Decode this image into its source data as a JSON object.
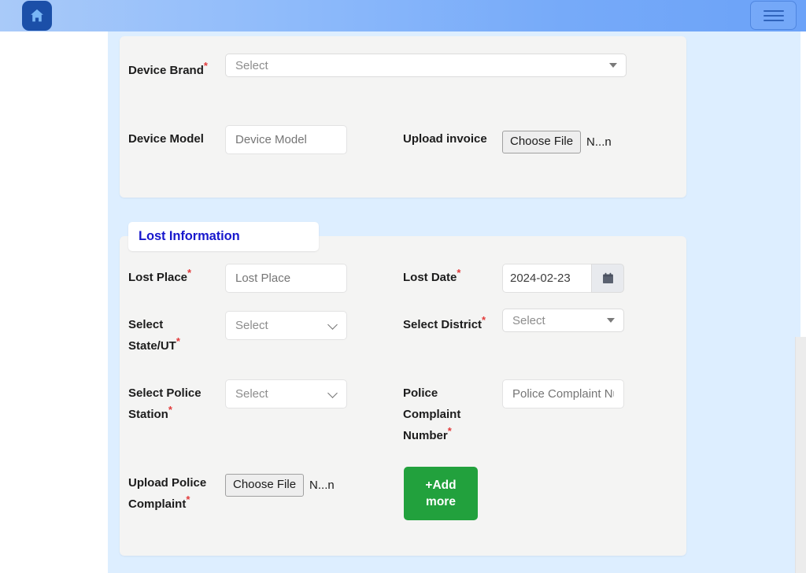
{
  "header": {
    "home_icon": "home-icon",
    "menu_icon": "hamburger-menu-icon",
    "gradient_from": "#a9caf9",
    "gradient_to": "#6ba2f8"
  },
  "device_section": {
    "fields": {
      "device_brand": {
        "label": "Device Brand",
        "required": "*",
        "value": "Select",
        "caret": "triangle-down-icon"
      },
      "device_model": {
        "label": "Device Model",
        "required": "",
        "placeholder": "Device Model",
        "value": ""
      },
      "upload_invoice": {
        "label": "Upload invoice",
        "required": "",
        "button_label": "Choose File",
        "file_name": "N...n"
      }
    }
  },
  "lost_section": {
    "tab_label": "Lost Information",
    "tab_color": "#1818cd",
    "fields": {
      "lost_place": {
        "label": "Lost Place",
        "required": "*",
        "placeholder": "Lost Place",
        "value": ""
      },
      "lost_date": {
        "label": "Lost Date",
        "required": "*",
        "value": "2024-02-23",
        "calendar_icon": "calendar-icon"
      },
      "state_ut": {
        "label": "Select State/UT",
        "required": "*",
        "value": "Select",
        "caret": "chevron-down-icon"
      },
      "district": {
        "label": "Select District",
        "required": "*",
        "value": "Select",
        "caret": "triangle-down-icon"
      },
      "police_station": {
        "label": "Select Police Station",
        "required": "*",
        "value": "Select",
        "caret": "chevron-down-icon"
      },
      "complaint_number": {
        "label": "Police Complaint Number",
        "required": "*",
        "placeholder": "Police Complaint Number",
        "value": ""
      },
      "upload_complaint": {
        "label": "Upload Police Complaint",
        "required": "*",
        "button_label": "Choose File",
        "file_name": "N...n"
      }
    },
    "add_more_button": {
      "label": "+Add more",
      "color": "#22a13d"
    }
  }
}
